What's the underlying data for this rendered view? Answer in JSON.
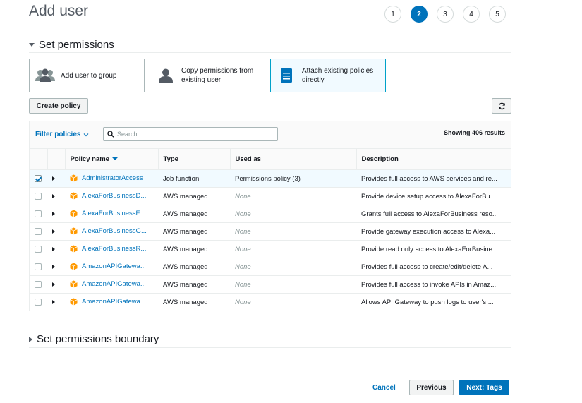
{
  "page": {
    "title": "Add user"
  },
  "steps": [
    "1",
    "2",
    "3",
    "4",
    "5"
  ],
  "active_step": 2,
  "permissions": {
    "heading": "Set permissions",
    "options": {
      "group": "Add user to group",
      "copy_line1": "Copy permissions from",
      "copy_line2": "existing user",
      "attach_line1": "Attach existing policies",
      "attach_line2": "directly"
    },
    "create_policy": "Create policy",
    "filter_label": "Filter policies",
    "search_placeholder": "Search",
    "results": "Showing 406 results",
    "columns": {
      "policy_name": "Policy name",
      "type": "Type",
      "used_as": "Used as",
      "description": "Description"
    },
    "rows": [
      {
        "name": "AdministratorAccess",
        "type": "Job function",
        "used_as": "Permissions policy (3)",
        "description": "Provides full access to AWS services and re...",
        "checked": true
      },
      {
        "name": "AlexaForBusinessD...",
        "type": "AWS managed",
        "used_as": "None",
        "description": "Provide device setup access to AlexaForBu...",
        "checked": false
      },
      {
        "name": "AlexaForBusinessF...",
        "type": "AWS managed",
        "used_as": "None",
        "description": "Grants full access to AlexaForBusiness reso...",
        "checked": false
      },
      {
        "name": "AlexaForBusinessG...",
        "type": "AWS managed",
        "used_as": "None",
        "description": "Provide gateway execution access to Alexa...",
        "checked": false
      },
      {
        "name": "AlexaForBusinessR...",
        "type": "AWS managed",
        "used_as": "None",
        "description": "Provide read only access to AlexaForBusine...",
        "checked": false
      },
      {
        "name": "AmazonAPIGatewa...",
        "type": "AWS managed",
        "used_as": "None",
        "description": "Provides full access to create/edit/delete A...",
        "checked": false
      },
      {
        "name": "AmazonAPIGatewa...",
        "type": "AWS managed",
        "used_as": "None",
        "description": "Provides full access to invoke APIs in Amaz...",
        "checked": false
      },
      {
        "name": "AmazonAPIGatewa...",
        "type": "AWS managed",
        "used_as": "None",
        "description": "Allows API Gateway to push logs to user's ...",
        "checked": false
      }
    ]
  },
  "boundary": {
    "heading": "Set permissions boundary"
  },
  "footer": {
    "cancel": "Cancel",
    "previous": "Previous",
    "next": "Next: Tags"
  },
  "colors": {
    "accent": "#0073bb",
    "policy_icon": "#ff9900",
    "selected_bg": "#f1faff"
  }
}
